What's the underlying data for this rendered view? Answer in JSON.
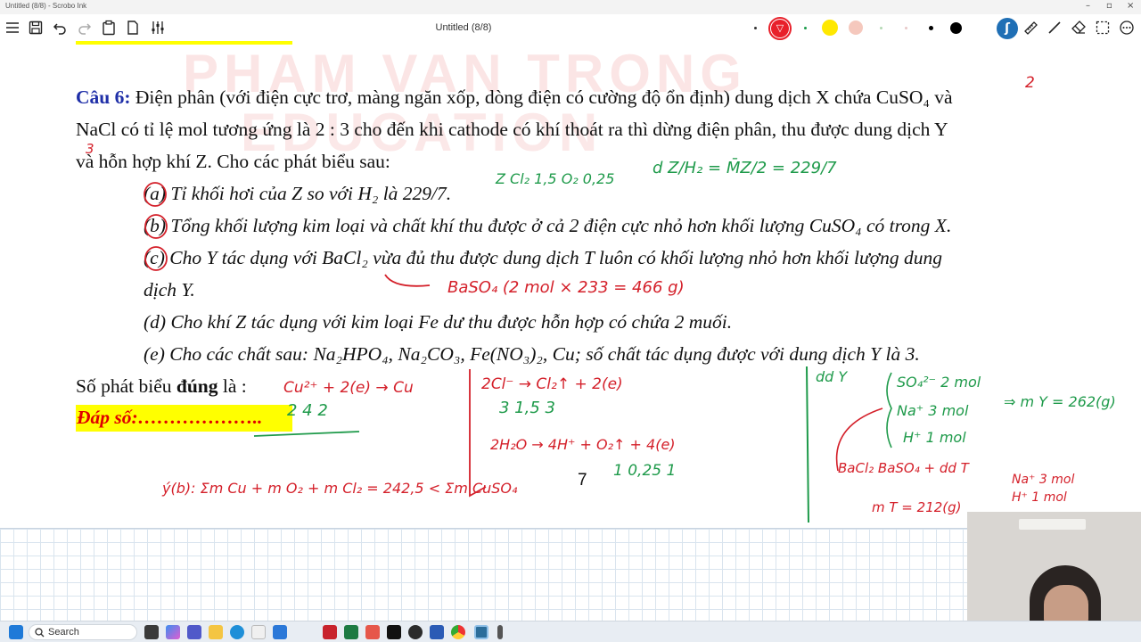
{
  "window": {
    "title": "Untitled (8/8) - Scrobo Ink"
  },
  "toolbar": {
    "doc_title": "Untitled (8/8)",
    "left_icons": [
      "menu-icon",
      "save-icon",
      "undo-icon",
      "redo-icon",
      "clipboard-icon",
      "page-icon",
      "sliders-icon"
    ],
    "pen_colors": [
      "#e8202a",
      "#ffe800",
      "#f5c8bd",
      "#000000"
    ],
    "right_icons": [
      "pen-tool-icon",
      "ruler-icon",
      "line-icon",
      "eraser-icon",
      "lasso-icon",
      "more-icon"
    ]
  },
  "question": {
    "label": "Câu 6:",
    "line1": " Điện phân (với điện cực trơ, màng ngăn xốp, dòng điện có cường độ ổn định) dung dịch X chứa CuSO₄ và",
    "line2": "NaCl có tỉ lệ mol tương ứng là 2 : 3 cho đến khi cathode có khí thoát ra thì dừng điện phân, thu được dung dịch Y",
    "line3": "và hỗn hợp khí Z. Cho các phát biểu sau:",
    "statements": [
      "(a) Tỉ khối hơi của Z so với H₂ là 229/7.",
      "(b) Tổng khối lượng kim loại và chất khí thu được ở cả 2 điện cực nhỏ hơn khối lượng CuSO₄ có trong X.",
      "(c) Cho Y tác dụng với BaCl₂ vừa đủ thu được dung dịch T luôn có khối lượng nhỏ hơn khối lượng dung",
      "dịch Y.",
      "(d) Cho khí Z tác dụng với kim loại Fe dư thu được hỗn hợp có chứa 2 muối.",
      "(e) Cho các chất sau: Na₂HPO₄, Na₂CO₃, Fe(NO₃)₂, Cu; số chất tác dụng được với dung dịch Y là 3."
    ],
    "count_prefix": "Số phát biểu ",
    "count_bold": "đúng",
    "count_suffix": " là :",
    "answer_label": "Đáp số:………………..",
    "typed_number": "7"
  },
  "watermark": {
    "line1": "PHAM VAN TRONG",
    "line2": "EDUCATION"
  },
  "handwriting": {
    "cu_ratio": "2",
    "na_ratio": "3",
    "z_gas": "Z  Cl₂  1,5   O₂  0,25",
    "density": "d Z/H₂ = M̄Z/2 = 229/7",
    "baso4": "BaSO₄ (2 mol × 233 = 466 g)",
    "cu_eq": "Cu²⁺ + 2(e) → Cu",
    "cu_nums": "2      4       2",
    "cl_eq": "2Cl⁻ → Cl₂↑ + 2(e)",
    "cl_nums": "3         1,5       3",
    "h2o_eq": "2H₂O → 4H⁺ + O₂↑ + 4(e)",
    "h2o_nums": "1       0,25       1",
    "check_b": "ý(b):  Σm Cu + m O₂ + m Cl₂ = 242,5 < Σm CuSO₄",
    "ddy": "dd Y",
    "ddy_ions": [
      "SO₄²⁻  2 mol",
      "Na⁺  3 mol",
      "H⁺  1 mol"
    ],
    "my": "⇒ m Y = 262(g)",
    "bacl2": "BaCl₂  BaSO₄ + dd T",
    "ddt_ions": [
      "Na⁺  3 mol",
      "H⁺  1 mol"
    ],
    "mt": "m T = 212(g)"
  },
  "taskbar": {
    "search_placeholder": "Search",
    "apps": [
      "task-view-icon",
      "copilot-icon",
      "teams-icon",
      "files-icon",
      "edge-icon",
      "zoho-icon",
      "photos-icon",
      "pdf-icon",
      "excel-icon",
      "paint-icon",
      "capcut-icon",
      "obs-icon",
      "word-icon",
      "chrome-icon",
      "scrobo-icon",
      "more-icon"
    ]
  }
}
